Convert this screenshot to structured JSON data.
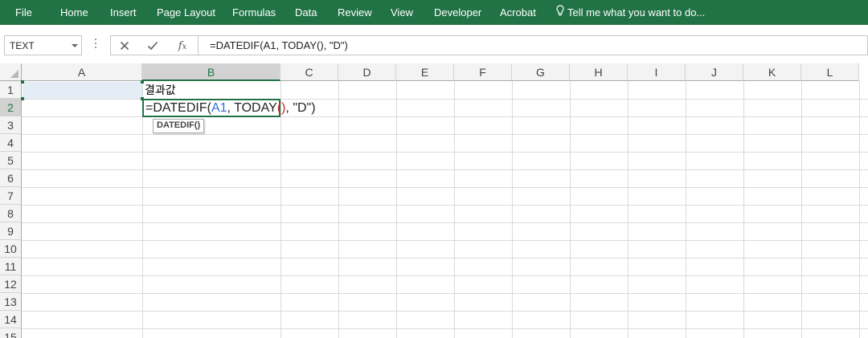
{
  "ribbon": {
    "tabs": [
      {
        "label": "File"
      },
      {
        "label": "Home"
      },
      {
        "label": "Insert"
      },
      {
        "label": "Page Layout"
      },
      {
        "label": "Formulas"
      },
      {
        "label": "Data"
      },
      {
        "label": "Review"
      },
      {
        "label": "View"
      },
      {
        "label": "Developer"
      },
      {
        "label": "Acrobat"
      }
    ],
    "tell_me": "Tell me what you want to do...",
    "color": "#217346"
  },
  "formula_bar": {
    "name_box": "TEXT",
    "formula": "=DATEDIF(A1, TODAY(), \"D\")"
  },
  "sheet": {
    "columns": [
      "A",
      "B",
      "C",
      "D",
      "E",
      "F",
      "G",
      "H",
      "I",
      "J",
      "K",
      "L"
    ],
    "rows": [
      "1",
      "2",
      "3",
      "4",
      "5",
      "6",
      "7",
      "8",
      "9",
      "10",
      "11",
      "12",
      "13",
      "14",
      "15"
    ],
    "selected_column": "B",
    "selected_row": "2",
    "cells": {
      "B1": "결과값",
      "B2": {
        "p1": "=DATEDIF(",
        "ref": "A1",
        "p2": ", TODAY",
        "paren": "()",
        "p3": ", \"D\")"
      }
    },
    "tooltip": "DATEDIF()",
    "highlight_color": "#e4ecf6",
    "ref_color": "#2e6fd8",
    "paren_color": "#c62f2f"
  }
}
